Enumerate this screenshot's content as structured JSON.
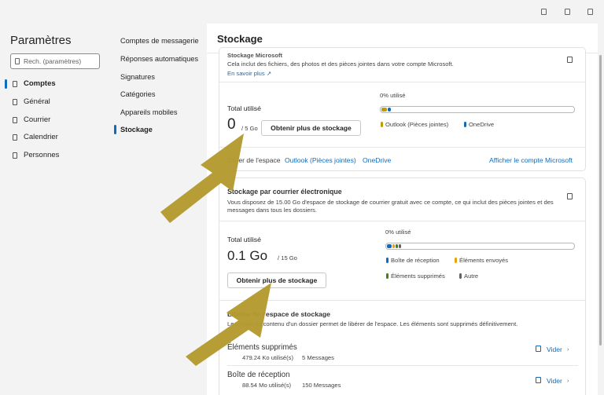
{
  "sidebar": {
    "title": "Paramètres",
    "search_placeholder": "Rech. (paramètres)",
    "items": [
      {
        "label": "Comptes"
      },
      {
        "label": "Général"
      },
      {
        "label": "Courrier"
      },
      {
        "label": "Calendrier"
      },
      {
        "label": "Personnes"
      }
    ]
  },
  "submenu": {
    "items": [
      {
        "label": "Comptes de messagerie"
      },
      {
        "label": "Réponses automatiques"
      },
      {
        "label": "Signatures"
      },
      {
        "label": "Catégories"
      },
      {
        "label": "Appareils mobiles"
      },
      {
        "label": "Stockage"
      }
    ]
  },
  "main": {
    "title": "Stockage",
    "ms_card": {
      "heading_partial": "Stockage Microsoft",
      "description": "Cela inclut des fichiers, des photos et des pièces jointes dans votre compte Microsoft.",
      "learn_more": "En savoir plus",
      "total_label": "Total utilisé",
      "total_value": "0",
      "total_unit": "/ 5 Go",
      "button": "Obtenir plus de stockage",
      "percent": "0% utilisé",
      "legend": [
        {
          "label": "Outlook (Pièces jointes)",
          "color": "#c19c00"
        },
        {
          "label": "OneDrive",
          "color": "#0f6cbd"
        }
      ],
      "manage_label": "Gérer de l'espace",
      "manage_links": [
        "Outlook (Pièces jointes)",
        "OneDrive"
      ],
      "account_link": "Afficher le compte Microsoft"
    },
    "mail_card": {
      "heading": "Stockage par courrier électronique",
      "description_line1": "Vous disposez de 15.00 Go d'espace de stockage de courrier gratuit avec ce compte, ce qui inclut des pièces jointes et des",
      "description_line2": "messages dans tous les dossiers.",
      "total_label": "Total utilisé",
      "total_value": "0.1 Go",
      "total_unit": "/ 15 Go",
      "button": "Obtenir plus de stockage",
      "percent": "0% utilisé",
      "legend": [
        {
          "label": "Boîte de réception",
          "color": "#0f6cbd"
        },
        {
          "label": "Éléments envoyés",
          "color": "#eaa300"
        },
        {
          "label": "Éléments supprimés",
          "color": "#498205"
        },
        {
          "label": "Autre",
          "color": "#616161"
        }
      ],
      "free_heading": "Libérer de l'espace de stockage",
      "free_description": "Le vidage du contenu d'un dossier permet de libérer de l'espace. Les éléments sont supprimés définitivement.",
      "folders": [
        {
          "name": "Éléments supprimés",
          "usage": "479.24 Ko utilisé(s)",
          "messages": "5 Messages",
          "action": "Vider"
        },
        {
          "name": "Boîte de réception",
          "usage": "88.54 Mo utilisé(s)",
          "messages": "150 Messages",
          "action": "Vider"
        }
      ]
    }
  },
  "colors": {
    "accent": "#0f6cbd",
    "arrow": "#b49a30"
  }
}
